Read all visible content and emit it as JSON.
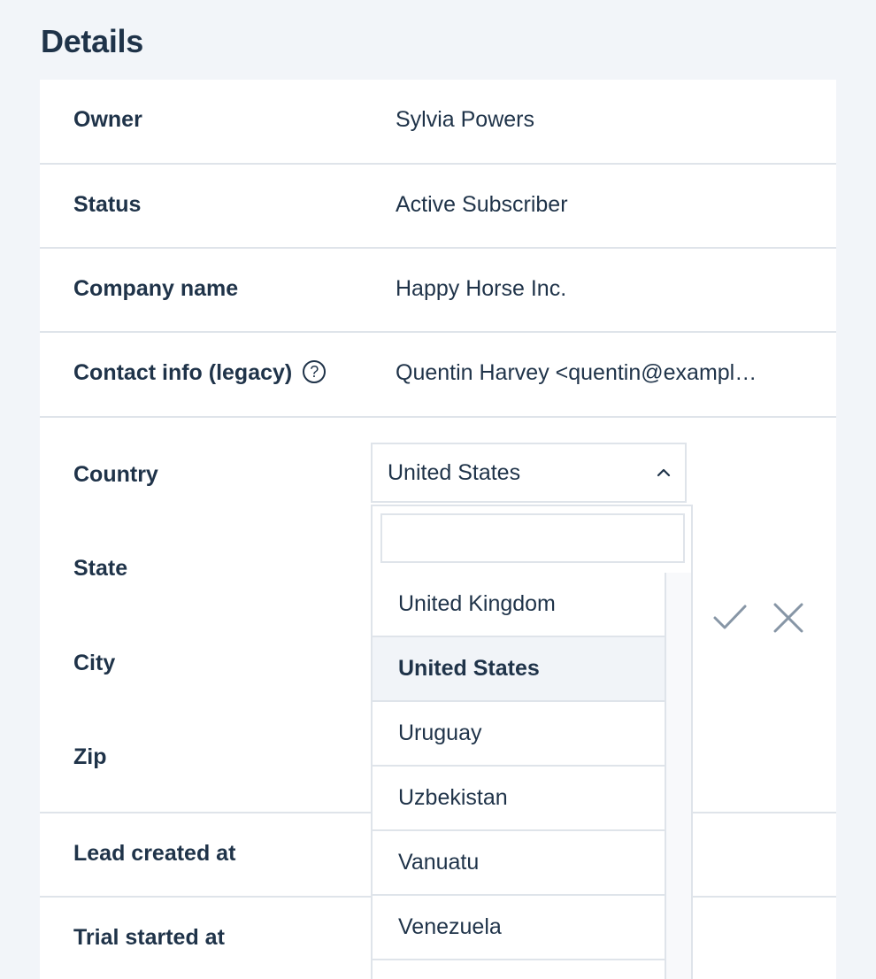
{
  "section_title": "Details",
  "rows": [
    {
      "label": "Owner",
      "value": "Sylvia Powers"
    },
    {
      "label": "Status",
      "value": "Active Subscriber"
    },
    {
      "label": "Company name",
      "value": "Happy Horse Inc."
    },
    {
      "label": "Contact info (legacy)",
      "value": "Quentin Harvey <quentin@exampl…",
      "help": "?"
    }
  ],
  "address": {
    "country_label": "Country",
    "state_label": "State",
    "city_label": "City",
    "zip_label": "Zip",
    "country_value": "United States"
  },
  "dropdown": {
    "search_placeholder": "",
    "options": [
      "United Kingdom",
      "United States",
      "Uruguay",
      "Uzbekistan",
      "Vanuatu",
      "Venezuela",
      ""
    ],
    "selected": "United States"
  },
  "lower_rows": [
    {
      "label": "Lead created at"
    },
    {
      "label": "Trial started at"
    }
  ],
  "icons": {
    "chevron": "chevron-up-icon",
    "confirm": "check-icon",
    "cancel": "close-icon",
    "help": "help-circle-icon"
  }
}
